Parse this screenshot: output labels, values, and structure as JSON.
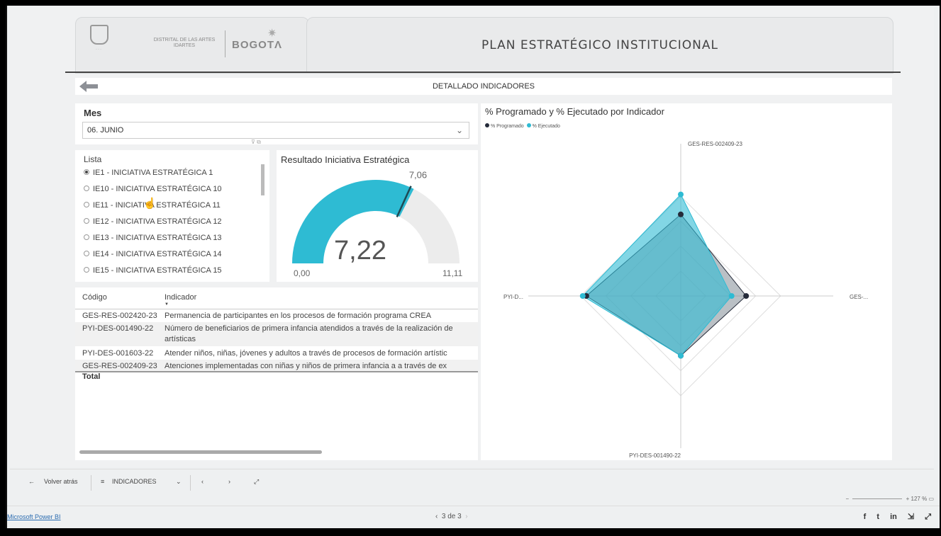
{
  "header": {
    "title": "PLAN ESTRATÉGICO INSTITUCIONAL",
    "logo_small": "DISTRITAL DE LAS ARTES\nIDARTES",
    "logo_bogota": "BOGOTΛ"
  },
  "subbar": {
    "title": "DETALLADO INDICADORES"
  },
  "mes": {
    "label": "Mes",
    "value": "06. JUNIO"
  },
  "lista": {
    "label": "Lista",
    "items": [
      "IE1 - INICIATIVA ESTRATÉGICA 1",
      "IE10 - INICIATIVA ESTRATÉGICA 10",
      "IE11 - INICIATIVA ESTRATÉGICA 11",
      "IE12 - INICIATIVA ESTRATÉGICA 12",
      "IE13 - INICIATIVA ESTRATÉGICA 13",
      "IE14 - INICIATIVA ESTRATÉGICA 14",
      "IE15 - INICIATIVA ESTRATÉGICA 15"
    ],
    "selected_index": 0
  },
  "gauge": {
    "title": "Resultado Iniciativa Estratégica",
    "value": 7.22,
    "value_label": "7,22",
    "target": 7.06,
    "target_label": "7,06",
    "min": 0,
    "min_label": "0,00",
    "max": 11.11,
    "max_label": "11,11",
    "color": "#2ebbd3"
  },
  "table": {
    "headers": [
      "Código",
      "Indicador"
    ],
    "rows": [
      {
        "code": "GES-RES-002420-23",
        "indicator": "Permanencia de participantes en los procesos de formación programa CREA"
      },
      {
        "code": "PYI-DES-001490-22",
        "indicator": "Número de beneficiarios de primera infancia atendidos a través de la realización de",
        "indicator_line2": "artísticas"
      },
      {
        "code": "PYI-DES-001603-22",
        "indicator": "Atender niños, niñas, jóvenes y adultos a través de procesos de formación artístic"
      },
      {
        "code": "GES-RES-002409-23",
        "indicator": "Atenciones implementadas con niñas y niños de primera infancia a a través de ex"
      }
    ],
    "total_label": "Total"
  },
  "chart_data": {
    "type": "radar",
    "title": "% Programado y % Ejecutado por Indicador",
    "axes": [
      "GES-RES-002409-23",
      "GES-...",
      "PYI-DES-001490-22",
      "PYI-D..."
    ],
    "series": [
      {
        "name": "% Programado",
        "color": "#252b3a",
        "values": [
          0.45,
          0.36,
          0.33,
          0.52
        ]
      },
      {
        "name": "% Ejecutado",
        "color": "#2ebbd3",
        "values": [
          0.56,
          0.28,
          0.33,
          0.54
        ]
      }
    ],
    "range": [
      0,
      1
    ]
  },
  "bottombar": {
    "back": "Volver atrás",
    "page": "INDICADORES"
  },
  "footer": {
    "brand": "Microsoft Power BI",
    "pager": "3 de 3",
    "zoom": "127 %"
  }
}
